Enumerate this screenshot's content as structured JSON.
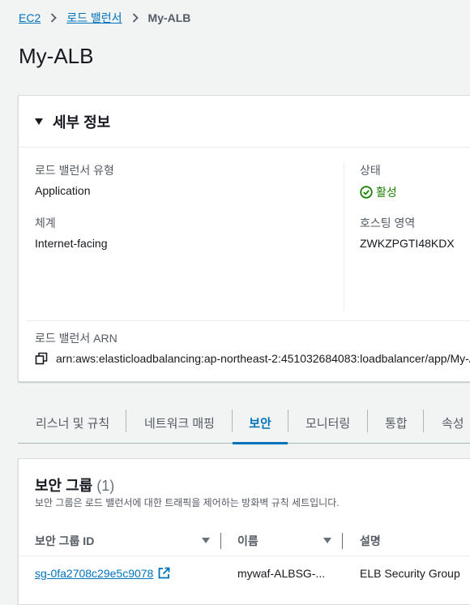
{
  "breadcrumb": {
    "items": [
      "EC2",
      "로드 밸런서"
    ],
    "current": "My-ALB"
  },
  "page_title": "My-ALB",
  "details": {
    "title": "세부 정보",
    "lb_type_label": "로드 밸런서 유형",
    "lb_type_value": "Application",
    "scheme_label": "체계",
    "scheme_value": "Internet-facing",
    "status_label": "상태",
    "status_value": "활성",
    "hosted_zone_label": "호스팅 영역",
    "hosted_zone_value": "ZWKZPGTI48KDX",
    "arn_label": "로드 밸런서 ARN",
    "arn_value": "arn:aws:elasticloadbalancing:ap-northeast-2:451032684083:loadbalancer/app/My-ALB"
  },
  "tabs": [
    "리스너 및 규칙",
    "네트워크 매핑",
    "보안",
    "모니터링",
    "통합",
    "속성"
  ],
  "active_tab": "보안",
  "security_groups": {
    "title": "보안 그룹",
    "count": "(1)",
    "description": "보안 그룹은 로드 밸런서에 대한 트래픽을 제어하는 방화벽 규칙 세트입니다.",
    "columns": [
      "보안 그룹 ID",
      "이름",
      "설명"
    ],
    "rows": [
      {
        "id": "sg-0fa2708c29e5c9078",
        "name": "mywaf-ALBSG-...",
        "description": "ELB Security Group"
      }
    ]
  },
  "colors": {
    "link": "#0073bb",
    "status_active": "#1d8102",
    "background": "#f2f3f3"
  }
}
